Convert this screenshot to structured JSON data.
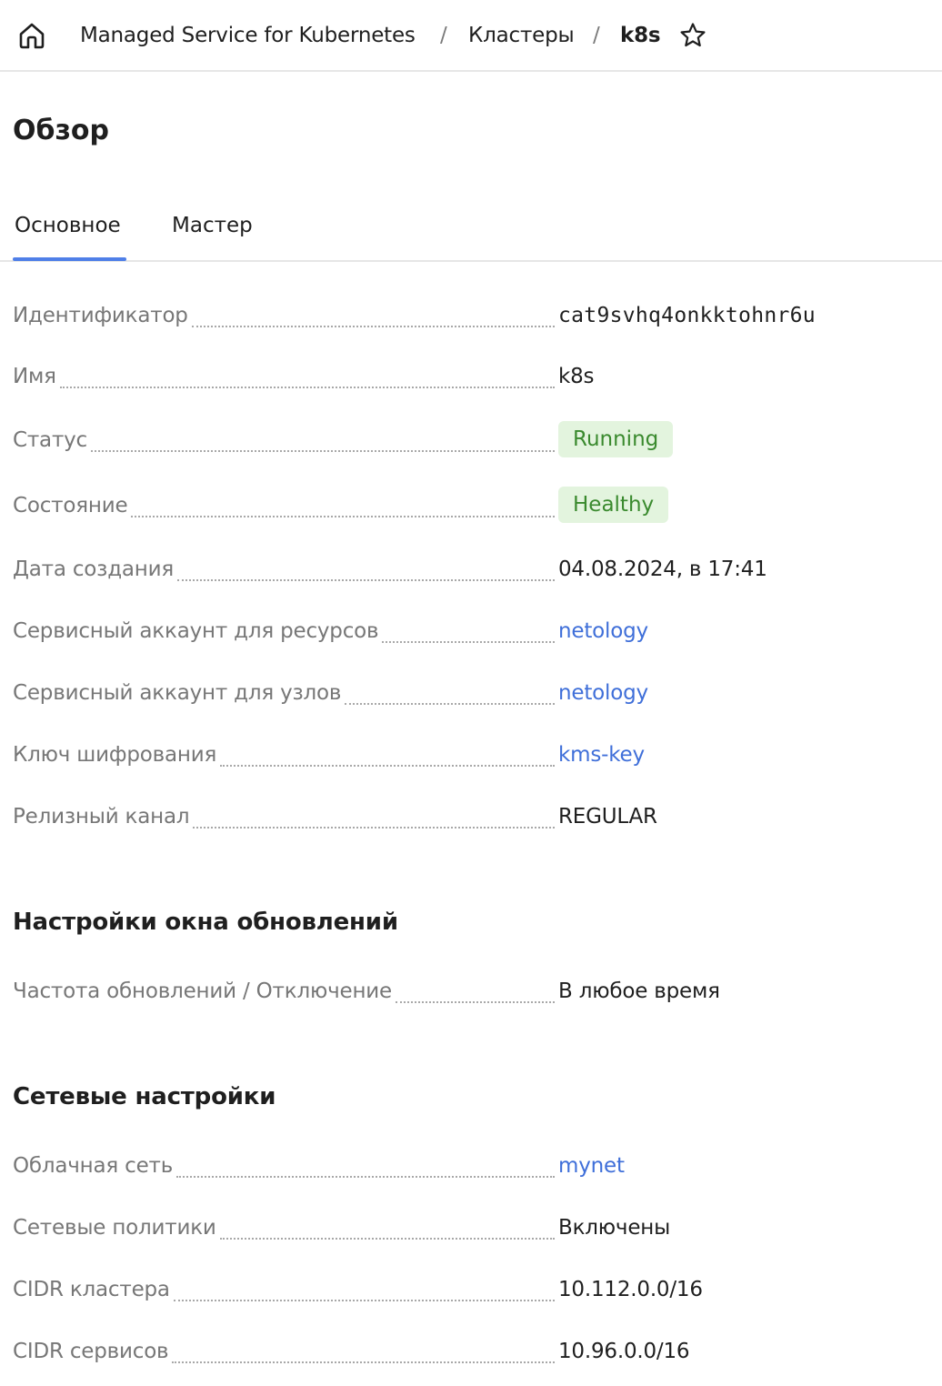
{
  "breadcrumb": {
    "items": [
      "Managed Service for Kubernetes",
      "Кластеры",
      "k8s"
    ],
    "separator": "/"
  },
  "page": {
    "title": "Обзор"
  },
  "tabs": [
    {
      "label": "Основное",
      "active": true
    },
    {
      "label": "Мастер",
      "active": false
    }
  ],
  "overview": {
    "id": {
      "label": "Идентификатор",
      "value": "cat9svhq4onkktohnr6u"
    },
    "name": {
      "label": "Имя",
      "value": "k8s"
    },
    "status": {
      "label": "Статус",
      "value": "Running"
    },
    "health": {
      "label": "Состояние",
      "value": "Healthy"
    },
    "created": {
      "label": "Дата создания",
      "value": "04.08.2024, в 17:41"
    },
    "sa_resources": {
      "label": "Сервисный аккаунт для ресурсов",
      "value": "netology"
    },
    "sa_nodes": {
      "label": "Сервисный аккаунт для узлов",
      "value": "netology"
    },
    "kms": {
      "label": "Ключ шифрования",
      "value": "kms-key"
    },
    "channel": {
      "label": "Релизный канал",
      "value": "REGULAR"
    }
  },
  "maintenance": {
    "title": "Настройки окна обновлений",
    "policy": {
      "label": "Частота обновлений / Отключение",
      "value": "В любое время"
    }
  },
  "network": {
    "title": "Сетевые настройки",
    "cloud_network": {
      "label": "Облачная сеть",
      "value": "mynet"
    },
    "policies": {
      "label": "Сетевые политики",
      "value": "Включены"
    },
    "cluster_cidr": {
      "label": "CIDR кластера",
      "value": "10.112.0.0/16"
    },
    "service_cidr": {
      "label": "CIDR сервисов",
      "value": "10.96.0.0/16"
    }
  },
  "colors": {
    "link": "#3f6fd9",
    "accent": "#4f7fe8",
    "badge_bg": "#e3f4de",
    "badge_text": "#3a8a2e",
    "label": "#777777"
  },
  "icons": [
    "home-icon",
    "star-icon"
  ]
}
